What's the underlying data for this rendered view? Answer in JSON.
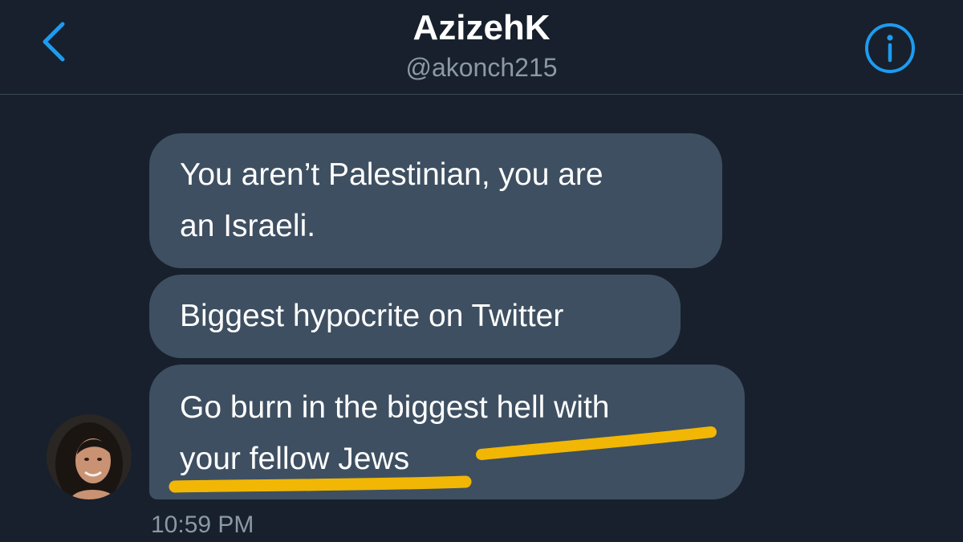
{
  "header": {
    "name": "AzizehK",
    "handle": "@akonch215",
    "back_icon": "chevron-left-icon",
    "info_icon": "info-icon"
  },
  "messages": [
    {
      "lines": [
        "You aren’t Palestinian, you are",
        "an Israeli."
      ]
    },
    {
      "lines": [
        "Biggest hypocrite on Twitter"
      ]
    },
    {
      "lines": [
        "Go burn in the biggest hell with",
        "your fellow Jews"
      ]
    }
  ],
  "timestamp": "10:59 PM",
  "colors": {
    "background": "#17202c",
    "bubble": "#3e4f61",
    "accent": "#1d9bf0",
    "secondary_text": "#8b98a5",
    "highlight": "#f2b705"
  }
}
